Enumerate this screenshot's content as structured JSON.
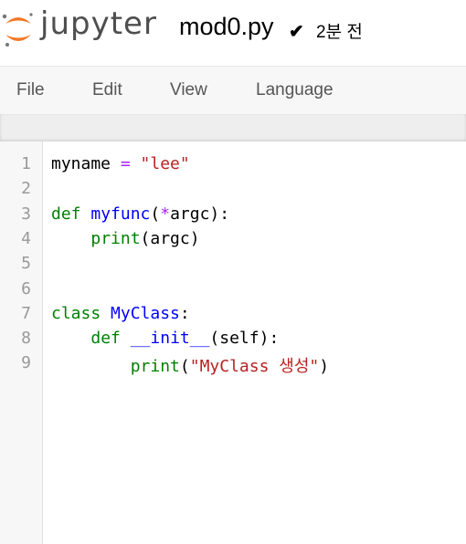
{
  "header": {
    "logo_text": "jupyter",
    "notebook_name": "mod0.py",
    "save_status": "2분 전"
  },
  "menu": {
    "items": [
      "File",
      "Edit",
      "View",
      "Language"
    ]
  },
  "editor": {
    "line_numbers": [
      "1",
      "2",
      "3",
      "4",
      "5",
      "6",
      "7",
      "8",
      "9"
    ],
    "lines": [
      {
        "indent": "",
        "tokens": [
          {
            "t": "myname ",
            "c": "plain"
          },
          {
            "t": "=",
            "c": "op"
          },
          {
            "t": " ",
            "c": "plain"
          },
          {
            "t": "\"lee\"",
            "c": "str"
          }
        ]
      },
      {
        "indent": "",
        "tokens": []
      },
      {
        "indent": "",
        "tokens": [
          {
            "t": "def",
            "c": "kw"
          },
          {
            "t": " ",
            "c": "plain"
          },
          {
            "t": "myfunc",
            "c": "def"
          },
          {
            "t": "(",
            "c": "plain"
          },
          {
            "t": "*",
            "c": "op"
          },
          {
            "t": "argc):",
            "c": "plain"
          }
        ]
      },
      {
        "indent": "    ",
        "tokens": [
          {
            "t": "print",
            "c": "bi"
          },
          {
            "t": "(argc)",
            "c": "plain"
          }
        ]
      },
      {
        "indent": "",
        "tokens": []
      },
      {
        "indent": "",
        "tokens": []
      },
      {
        "indent": "",
        "tokens": [
          {
            "t": "class",
            "c": "kw"
          },
          {
            "t": " ",
            "c": "plain"
          },
          {
            "t": "MyClass",
            "c": "def"
          },
          {
            "t": ":",
            "c": "plain"
          }
        ]
      },
      {
        "indent": "    ",
        "tokens": [
          {
            "t": "def",
            "c": "kw"
          },
          {
            "t": " ",
            "c": "plain"
          },
          {
            "t": "__init__",
            "c": "def"
          },
          {
            "t": "(self):",
            "c": "plain"
          }
        ]
      },
      {
        "indent": "        ",
        "tokens": [
          {
            "t": "print",
            "c": "bi"
          },
          {
            "t": "(",
            "c": "plain"
          },
          {
            "t": "\"MyClass 생성\"",
            "c": "str"
          },
          {
            "t": ")",
            "c": "plain"
          }
        ]
      }
    ]
  },
  "colors": {
    "logo_orange": "#f37726",
    "keyword": "#008000",
    "definition": "#0000ff",
    "string": "#ba2121",
    "operator": "#aa22ff"
  }
}
